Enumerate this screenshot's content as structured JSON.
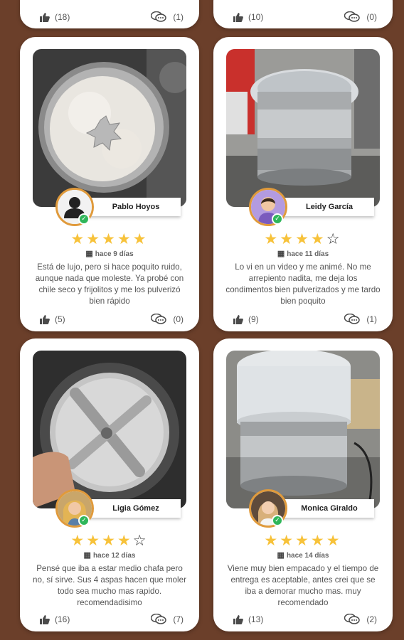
{
  "top_partial_cards": [
    {
      "likes": "(18)",
      "comments": "(1)"
    },
    {
      "likes": "(10)",
      "comments": "(0)"
    }
  ],
  "reviews": [
    {
      "name": "Pablo Hoyos",
      "avatar_type": "placeholder-person-icon",
      "rating": 5,
      "date": "hace 9 días",
      "text": "Está de lujo, pero si hace poquito ruido, aunque nada que moleste. Ya probé con chile seco y frijolitos y me los pulverizó bien rápido",
      "likes": "(5)",
      "comments": "(0)",
      "photo": "flour-in-grinder"
    },
    {
      "name": "Leidy García",
      "avatar_type": "photo",
      "rating": 4,
      "date": "hace 11 días",
      "text": "Lo vi en un video y me animé. No me arrepiento nadita, me deja los condimentos bien pulverizados y me tardo bien poquito",
      "likes": "(9)",
      "comments": "(1)",
      "photo": "steel-grinder-clear-lid"
    },
    {
      "name": "Ligia Gómez",
      "avatar_type": "photo",
      "rating": 4,
      "date": "hace 12 días",
      "text": "Pensé que iba a estar medio chafa pero no, sí sirve. Sus 4 aspas hacen que moler todo sea mucho mas rapido. recomendadisimo",
      "likes": "(16)",
      "comments": "(7)",
      "photo": "grinder-blades"
    },
    {
      "name": "Monica Giraldo",
      "avatar_type": "photo",
      "rating": 5,
      "date": "hace 14 días",
      "text": "Viene muy bien empacado y el tiempo de entrega es aceptable, antes crei que se iba a demorar mucho mas. muy recomendado",
      "likes": "(13)",
      "comments": "(2)",
      "photo": "grinder-full-view"
    }
  ],
  "colors": {
    "background": "#6b3f2a",
    "card": "#ffffff",
    "star": "#f7c23a",
    "avatar_ring": "#e09a3b",
    "verified": "#2fb65a"
  },
  "icons": [
    "thumbs-up-icon",
    "comment-bubble-icon",
    "calendar-icon",
    "star-icon",
    "verified-check-icon"
  ]
}
